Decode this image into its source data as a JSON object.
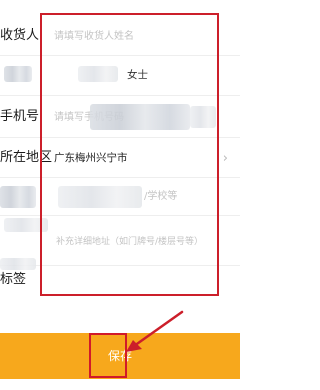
{
  "form": {
    "recipient": {
      "label": "收货人",
      "placeholder": "请填写收货人姓名"
    },
    "gender": {
      "value": "女士"
    },
    "phone": {
      "label": "手机号",
      "placeholder": "请填写手机号码"
    },
    "region": {
      "label": "所在地区",
      "value": "广东梅州兴宁市"
    },
    "address": {
      "placeholder_suffix": "/学校等",
      "detail_placeholder": "补充详细地址（如门牌号/楼层号等）"
    },
    "tag": {
      "label": "标签"
    }
  },
  "footer": {
    "save_label": "保存"
  },
  "colors": {
    "save_bar": "#f7a81c",
    "annotation_red": "#cc1f2a"
  }
}
